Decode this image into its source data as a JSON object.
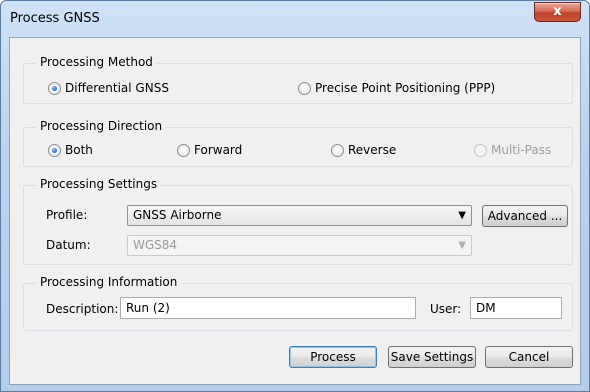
{
  "window": {
    "title": "Process GNSS",
    "close_label": "x"
  },
  "method": {
    "label": "Processing Method",
    "options": [
      {
        "label": "Differential GNSS",
        "checked": true
      },
      {
        "label": "Precise Point Positioning (PPP)",
        "checked": false
      }
    ]
  },
  "direction": {
    "label": "Processing Direction",
    "options": [
      {
        "label": "Both",
        "checked": true
      },
      {
        "label": "Forward",
        "checked": false
      },
      {
        "label": "Reverse",
        "checked": false
      },
      {
        "label": "Multi-Pass",
        "checked": false,
        "disabled": true
      }
    ]
  },
  "settings": {
    "label": "Processing Settings",
    "profile_label": "Profile:",
    "profile_value": "GNSS Airborne",
    "advanced_label": "Advanced ...",
    "datum_label": "Datum:",
    "datum_value": "WGS84"
  },
  "info": {
    "label": "Processing Information",
    "description_label": "Description:",
    "description_value": "Run (2)",
    "user_label": "User:",
    "user_value": "DM"
  },
  "buttons": {
    "process": "Process",
    "save_settings": "Save Settings",
    "cancel": "Cancel"
  }
}
